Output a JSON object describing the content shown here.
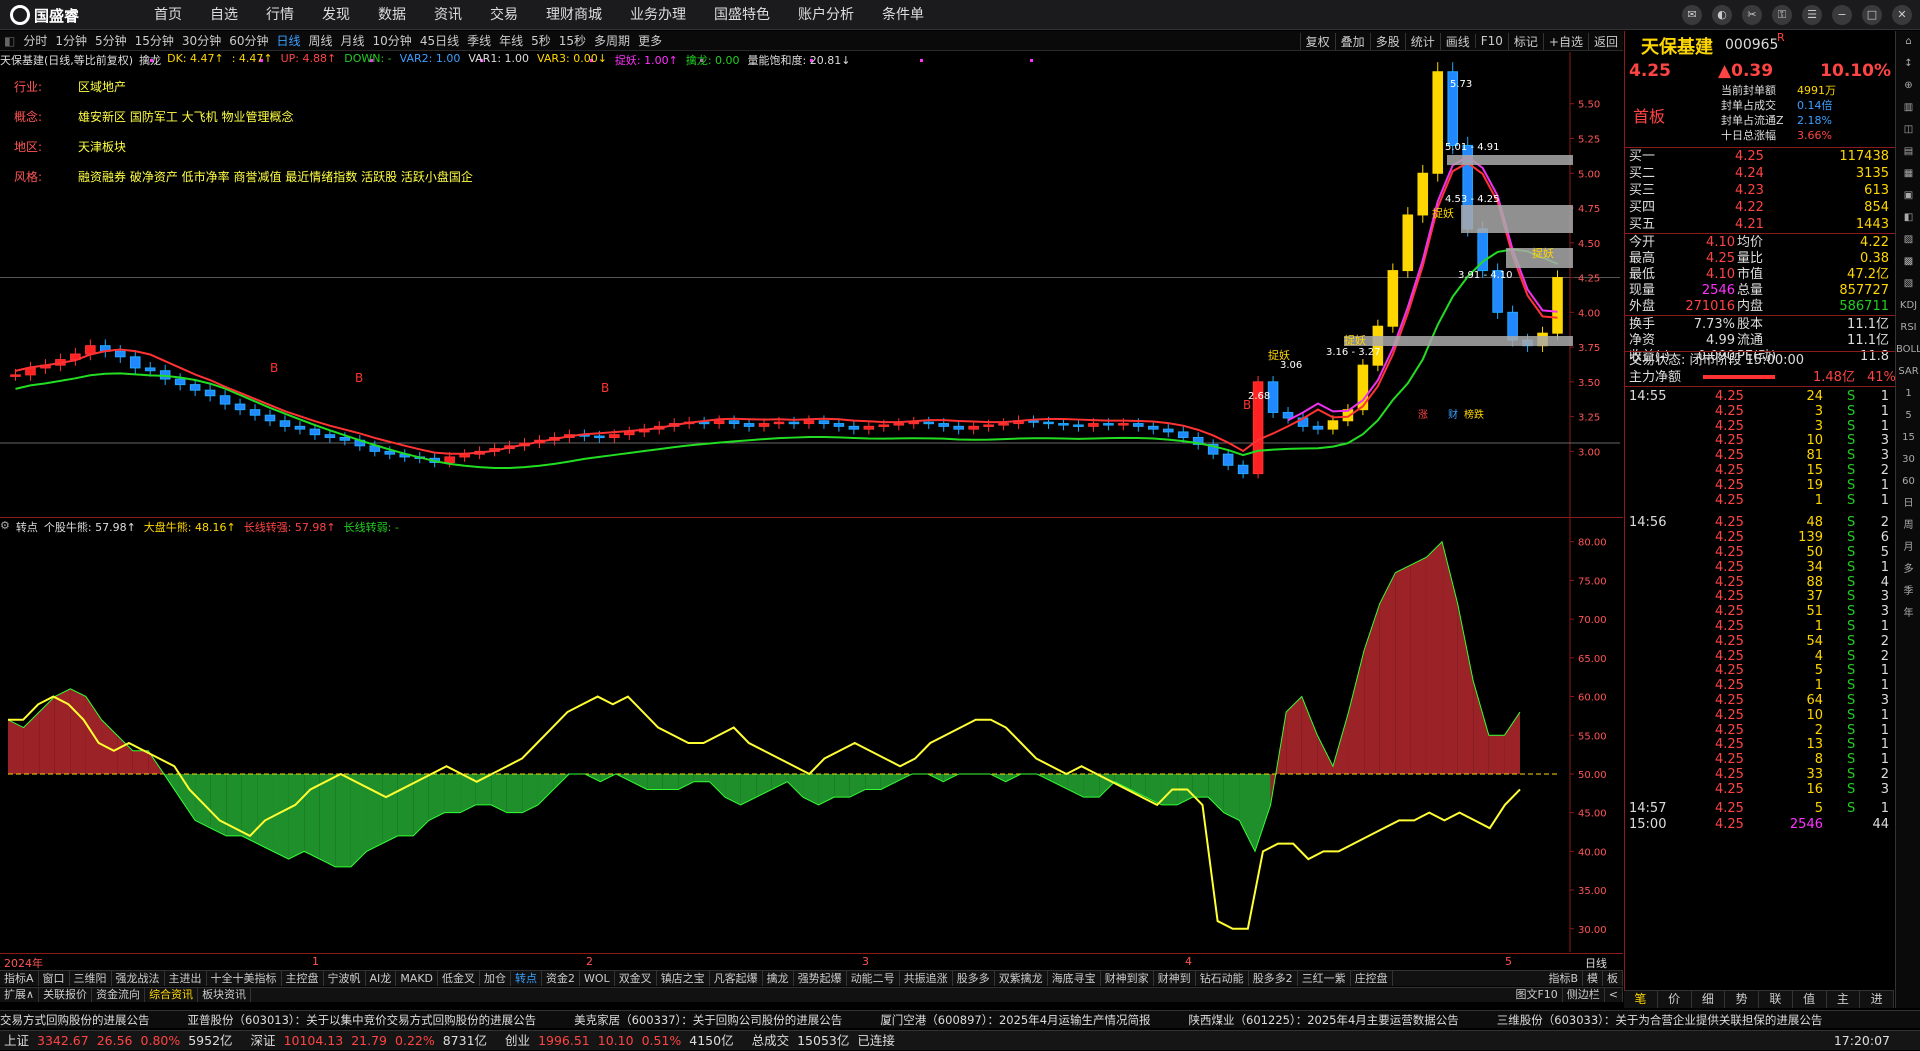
{
  "app": {
    "brand": "国盛睿",
    "menu": [
      "首页",
      "自选",
      "行情",
      "发现",
      "数据",
      "资讯",
      "交易",
      "理财商城",
      "业务办理",
      "国盛特色",
      "账户分析",
      "条件单"
    ]
  },
  "period_bar": {
    "items": [
      "分时",
      "1分钟",
      "5分钟",
      "15分钟",
      "30分钟",
      "60分钟",
      "日线",
      "周线",
      "月线",
      "10分钟",
      "45日线",
      "季线",
      "年线",
      "5秒",
      "15秒",
      "多周期",
      "更多"
    ],
    "active": "日线",
    "tools": [
      "复权",
      "叠加",
      "多股",
      "统计",
      "画线",
      "F10",
      "标记",
      "+自选",
      "返回"
    ]
  },
  "main_header": {
    "title": "天保基建(日线,等比前复权)",
    "indicator": "擒龙",
    "items": [
      {
        "t": "DK: 4.47↑",
        "c": "y"
      },
      {
        "t": ": 4.47↑",
        "c": "y"
      },
      {
        "t": "UP: 4.88↑",
        "c": "r"
      },
      {
        "t": "DOWN: -",
        "c": "g"
      },
      {
        "t": "VAR2: 1.00",
        "c": "b"
      },
      {
        "t": "VAR1: 1.00",
        "c": "w"
      },
      {
        "t": "VAR3: 0.00↓",
        "c": "y"
      },
      {
        "t": "捉妖: 1.00↑",
        "c": "m"
      },
      {
        "t": "擒龙: 0.00",
        "c": "g"
      },
      {
        "t": "量能饱和度: 20.81↓",
        "c": "w"
      }
    ]
  },
  "profile": [
    {
      "k": "行业:",
      "v": "区域地产"
    },
    {
      "k": "概念:",
      "v": "雄安新区 国防军工 大飞机 物业管理概念"
    },
    {
      "k": "地区:",
      "v": "天津板块"
    },
    {
      "k": "风格:",
      "v": "融资融券 破净资产 低市净率 商誉减值 最近情绪指数 活跃股 活跃小盘国企"
    }
  ],
  "price_axis": {
    "ticks": [
      "5.50",
      "5.25",
      "5.00",
      "4.75",
      "4.50",
      "4.25",
      "4.00",
      "3.75",
      "3.50",
      "3.25",
      "3.00"
    ]
  },
  "annotations": {
    "high": "5.73",
    "low": "2.68",
    "b1": "5.01 - 4.91",
    "b2": "4.53 - 4.25",
    "b3": "3.91 - 4.10",
    "b4": "3.16 - 3.27",
    "last": "3.06",
    "zy": "捉妖",
    "bmark": "B",
    "tags": [
      "涨",
      "财",
      "榜跌"
    ]
  },
  "sub_header": {
    "title": "转点",
    "items": [
      {
        "t": "个股牛熊: 57.98↑",
        "c": "w"
      },
      {
        "t": "大盘牛熊: 48.16↑",
        "c": "y"
      },
      {
        "t": "长线转强: 57.98↑",
        "c": "r"
      },
      {
        "t": "长线转弱: -",
        "c": "g"
      }
    ]
  },
  "sub_axis": {
    "ticks": [
      "80.00",
      "75.00",
      "70.00",
      "65.00",
      "60.00",
      "55.00",
      "50.00",
      "45.00",
      "40.00",
      "35.00",
      "30.00"
    ]
  },
  "date_axis": {
    "labels": [
      "2024年",
      "1",
      "2",
      "3",
      "4",
      "5"
    ],
    "period": "日线"
  },
  "tabs1": [
    "指标A",
    "窗口",
    "三维阳",
    "强龙战法",
    "主进出",
    "十全十美指标",
    "主控盘",
    "宁波帆",
    "AI龙",
    "MAKD",
    "低金叉",
    "加仓",
    "转点",
    "资金2",
    "WOL",
    "双金叉",
    "镇店之宝",
    "凡客起爆",
    "擒龙",
    "强势起爆",
    "动能二号",
    "共振追涨",
    "股多多",
    "双紫擒龙",
    "海底寻宝",
    "财神到家",
    "财神到",
    "钻石动能",
    "股多多2",
    "三红一紫",
    "庄控盘"
  ],
  "tabs1_active": "转点",
  "tabs1_right": [
    "指标B",
    "模",
    "板"
  ],
  "tabs2": [
    "扩展∧",
    "关联报价",
    "资金流向",
    "综合资讯",
    "板块资讯"
  ],
  "tabs2_active": "综合资讯",
  "tabs2_right": [
    "图文F10",
    "侧边栏",
    "<"
  ],
  "news": [
    "交易方式回购股份的进展公告",
    "亚普股份（603013）：关于以集中竞价交易方式回购股份的进展公告",
    "美克家居（600337）：关于回购公司股份的进展公告",
    "厦门空港（600897）：2025年4月运输生产情况简报",
    "陕西煤业（601225）：2025年4月主要运营数据公告",
    "三维股份（603033）：关于为合营企业提供关联担保的进展公告"
  ],
  "status": {
    "items": [
      {
        "n": "上证",
        "v": "3342.67",
        "c": "26.56",
        "p": "0.80%",
        "a": "5952亿"
      },
      {
        "n": "深证",
        "v": "10104.13",
        "c": "21.79",
        "p": "0.22%",
        "a": "8731亿"
      },
      {
        "n": "创业",
        "v": "1996.51",
        "c": "10.10",
        "p": "0.51%",
        "a": "4150亿"
      }
    ],
    "total_label": "总成交",
    "total": "15053亿",
    "conn": "已连接",
    "time": "17:20:07"
  },
  "right": {
    "name": "天保基建",
    "code": "000965",
    "flag": "R",
    "price": "4.25",
    "change": "▲0.39",
    "pct": "10.10%",
    "board": "首板",
    "seal": [
      {
        "k": "当前封单额",
        "v": "4991万"
      },
      {
        "k": "封单占成交",
        "v": "0.14倍"
      },
      {
        "k": "封单占流通Z",
        "v": "2.18%"
      },
      {
        "k": "十日总涨幅",
        "v": "3.66%"
      }
    ],
    "book": [
      {
        "k": "买一",
        "p": "4.25",
        "v": "117438"
      },
      {
        "k": "买二",
        "p": "4.24",
        "v": "3135"
      },
      {
        "k": "买三",
        "p": "4.23",
        "v": "613"
      },
      {
        "k": "买四",
        "p": "4.22",
        "v": "854"
      },
      {
        "k": "买五",
        "p": "4.21",
        "v": "1443"
      }
    ],
    "stats": [
      [
        "今开",
        "4.10",
        "均价",
        "4.22"
      ],
      [
        "最高",
        "4.25",
        "量比",
        "0.38"
      ],
      [
        "最低",
        "4.10",
        "市值",
        "47.2亿"
      ],
      [
        "现量",
        "2546",
        "总量",
        "857727"
      ],
      [
        "外盘",
        "271016",
        "内盘",
        "586711"
      ]
    ],
    "stats2": [
      [
        "换手",
        "7.73%",
        "股本",
        "11.1亿"
      ],
      [
        "净资",
        "4.99",
        "流通",
        "11.1亿"
      ],
      [
        "收益(-)",
        "0.090",
        "PE(动)",
        "11.8"
      ]
    ],
    "trade_state": "交易状态: 闭市阶段 15:00:00",
    "net_label": "主力净额",
    "net_val": "1.48亿",
    "net_pct": "41%",
    "ticks": [
      {
        "t": "14:55",
        "p": "4.25",
        "v": "24",
        "s": "S",
        "n": "1"
      },
      {
        "t": "",
        "p": "4.25",
        "v": "3",
        "s": "S",
        "n": "1"
      },
      {
        "t": "",
        "p": "4.25",
        "v": "3",
        "s": "S",
        "n": "1"
      },
      {
        "t": "",
        "p": "4.25",
        "v": "10",
        "s": "S",
        "n": "3"
      },
      {
        "t": "",
        "p": "4.25",
        "v": "81",
        "s": "S",
        "n": "3"
      },
      {
        "t": "",
        "p": "4.25",
        "v": "15",
        "s": "S",
        "n": "2"
      },
      {
        "t": "",
        "p": "4.25",
        "v": "19",
        "s": "S",
        "n": "1"
      },
      {
        "t": "",
        "p": "4.25",
        "v": "1",
        "s": "S",
        "n": "1"
      },
      {
        "t": "14:56",
        "p": "4.25",
        "v": "48",
        "s": "S",
        "n": "2"
      },
      {
        "t": "",
        "p": "4.25",
        "v": "139",
        "s": "S",
        "n": "6"
      },
      {
        "t": "",
        "p": "4.25",
        "v": "50",
        "s": "S",
        "n": "5"
      },
      {
        "t": "",
        "p": "4.25",
        "v": "34",
        "s": "S",
        "n": "1"
      },
      {
        "t": "",
        "p": "4.25",
        "v": "88",
        "s": "S",
        "n": "4"
      },
      {
        "t": "",
        "p": "4.25",
        "v": "37",
        "s": "S",
        "n": "3"
      },
      {
        "t": "",
        "p": "4.25",
        "v": "51",
        "s": "S",
        "n": "3"
      },
      {
        "t": "",
        "p": "4.25",
        "v": "1",
        "s": "S",
        "n": "1"
      },
      {
        "t": "",
        "p": "4.25",
        "v": "54",
        "s": "S",
        "n": "2"
      },
      {
        "t": "",
        "p": "4.25",
        "v": "4",
        "s": "S",
        "n": "2"
      },
      {
        "t": "",
        "p": "4.25",
        "v": "5",
        "s": "S",
        "n": "1"
      },
      {
        "t": "",
        "p": "4.25",
        "v": "1",
        "s": "S",
        "n": "1"
      },
      {
        "t": "",
        "p": "4.25",
        "v": "64",
        "s": "S",
        "n": "3"
      },
      {
        "t": "",
        "p": "4.25",
        "v": "10",
        "s": "S",
        "n": "1"
      },
      {
        "t": "",
        "p": "4.25",
        "v": "2",
        "s": "S",
        "n": "1"
      },
      {
        "t": "",
        "p": "4.25",
        "v": "13",
        "s": "S",
        "n": "1"
      },
      {
        "t": "",
        "p": "4.25",
        "v": "8",
        "s": "S",
        "n": "1"
      },
      {
        "t": "",
        "p": "4.25",
        "v": "33",
        "s": "S",
        "n": "2"
      },
      {
        "t": "",
        "p": "4.25",
        "v": "16",
        "s": "S",
        "n": "3"
      },
      {
        "t": "14:57",
        "p": "4.25",
        "v": "5",
        "s": "S",
        "n": "1"
      },
      {
        "t": "15:00",
        "p": "4.25",
        "v": "2546",
        "s": "",
        "n": "44"
      }
    ],
    "bottom_tabs": [
      "笔",
      "价",
      "细",
      "势",
      "联",
      "值",
      "主",
      "进"
    ]
  },
  "side_icons": [
    "⌂",
    "↕",
    "⊕",
    "▥",
    "◫",
    "▤",
    "▦",
    "▣",
    "◧",
    "▨",
    "▩",
    "▧",
    "KDJ",
    "RSI",
    "BOLL",
    "SAR",
    "1",
    "5",
    "15",
    "30",
    "60",
    "日",
    "周",
    "月",
    "多",
    "季",
    "年"
  ],
  "colors": {
    "up": "#ff4444",
    "down": "#22cc22",
    "yellow": "#ffd700",
    "magenta": "#ff33ff",
    "bg": "#000000"
  },
  "chart_data": [
    {
      "type": "candlestick",
      "title": "天保基建(日线,等比前复权)",
      "ylim": [
        2.6,
        5.8
      ],
      "ticks": [
        5.5,
        5.25,
        5.0,
        4.75,
        4.5,
        4.25,
        4.0,
        3.75,
        3.5,
        3.25,
        3.0
      ],
      "closes": [
        3.55,
        3.6,
        3.62,
        3.66,
        3.7,
        3.76,
        3.72,
        3.68,
        3.6,
        3.58,
        3.52,
        3.48,
        3.44,
        3.4,
        3.34,
        3.3,
        3.26,
        3.22,
        3.18,
        3.16,
        3.12,
        3.1,
        3.08,
        3.04,
        3.0,
        2.98,
        2.96,
        2.95,
        2.92,
        2.96,
        2.98,
        3.0,
        3.02,
        3.04,
        3.06,
        3.08,
        3.1,
        3.12,
        3.11,
        3.1,
        3.12,
        3.14,
        3.16,
        3.18,
        3.2,
        3.21,
        3.2,
        3.22,
        3.2,
        3.18,
        3.2,
        3.21,
        3.2,
        3.22,
        3.2,
        3.18,
        3.16,
        3.18,
        3.19,
        3.2,
        3.21,
        3.2,
        3.18,
        3.16,
        3.18,
        3.19,
        3.2,
        3.22,
        3.21,
        3.2,
        3.19,
        3.18,
        3.2,
        3.19,
        3.2,
        3.18,
        3.16,
        3.14,
        3.1,
        3.05,
        2.98,
        2.9,
        2.84,
        3.5,
        3.28,
        3.24,
        3.18,
        3.16,
        3.22,
        3.3,
        3.62,
        3.9,
        4.3,
        4.7,
        5.0,
        5.73,
        5.2,
        4.6,
        4.3,
        4.0,
        3.8,
        3.76,
        3.85,
        4.25
      ]
    },
    {
      "type": "line",
      "title": "转点",
      "ylim": [
        27,
        81
      ],
      "ticks": [
        80,
        75,
        70,
        65,
        60,
        55,
        50,
        45,
        40,
        35,
        30
      ],
      "series": [
        {
          "name": "个股牛熊",
          "values": [
            57,
            56,
            58,
            60,
            61,
            60,
            57,
            55,
            53,
            53,
            50,
            47,
            44,
            43,
            42,
            42,
            41,
            40,
            39,
            40,
            39,
            38,
            38,
            40,
            41,
            42,
            42,
            44,
            45,
            45,
            46,
            46,
            45,
            45,
            46,
            48,
            50,
            50,
            49,
            50,
            49,
            48,
            48,
            48,
            49,
            49,
            47,
            46,
            47,
            48,
            49,
            47,
            46,
            47,
            47,
            48,
            48,
            49,
            50,
            50,
            49,
            50,
            50,
            50,
            49,
            50,
            50,
            49,
            48,
            47,
            47,
            49,
            48,
            47,
            46,
            46,
            47,
            47,
            45,
            44,
            40,
            46,
            58,
            60,
            55,
            51,
            58,
            66,
            72,
            76,
            77,
            78,
            80,
            72,
            62,
            55,
            55,
            58
          ]
        },
        {
          "name": "大盘牛熊",
          "values": [
            57,
            57,
            59,
            60,
            59,
            57,
            54,
            53,
            54,
            53,
            52,
            51,
            48,
            46,
            44,
            43,
            42,
            44,
            45,
            46,
            48,
            49,
            50,
            49,
            48,
            47,
            48,
            49,
            50,
            51,
            50,
            49,
            50,
            51,
            52,
            54,
            56,
            58,
            59,
            60,
            59,
            60,
            58,
            56,
            55,
            54,
            54,
            55,
            56,
            54,
            53,
            52,
            51,
            50,
            52,
            53,
            54,
            53,
            52,
            51,
            52,
            54,
            55,
            56,
            57,
            57,
            56,
            54,
            52,
            51,
            50,
            51,
            50,
            49,
            48,
            47,
            46,
            48,
            48,
            46,
            31,
            30,
            30,
            40,
            41,
            41,
            39,
            40,
            40,
            41,
            42,
            43,
            44,
            44,
            45,
            44,
            45,
            44,
            43,
            46,
            48
          ]
        }
      ]
    }
  ]
}
